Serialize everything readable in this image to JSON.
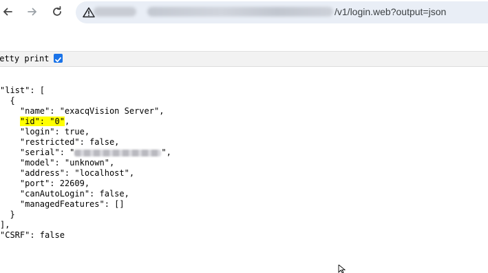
{
  "toolbar": {
    "back_icon": "arrow-left-icon",
    "forward_icon": "arrow-right-icon",
    "reload_icon": "reload-icon",
    "security_icon": "warning-triangle-icon"
  },
  "address_bar": {
    "url_visible": "/v1/login.web?output=json"
  },
  "pretty_print": {
    "label": "retty print",
    "checked": true
  },
  "json_lines": {
    "l01": "\"list\": [",
    "l02": "  {",
    "l03": "    \"name\": \"exacqVision Server\",",
    "l04_hl": "\"id\": \"0\"",
    "l04_rest": ",",
    "l05": "    \"login\": true,",
    "l06": "    \"restricted\": false,",
    "l07_a": "    \"serial\": \"",
    "l07_b": "\",",
    "l08": "    \"model\": \"unknown\",",
    "l09": "    \"address\": \"localhost\",",
    "l10": "    \"port\": 22609,",
    "l11": "    \"canAutoLogin\": false,",
    "l12": "    \"managedFeatures\": []",
    "l13": "  }",
    "l14": "],",
    "l15": "\"CSRF\": false"
  },
  "colors": {
    "highlight": "#ffff00",
    "checkbox": "#1a73e8",
    "omnibox": "#e9eef6"
  }
}
